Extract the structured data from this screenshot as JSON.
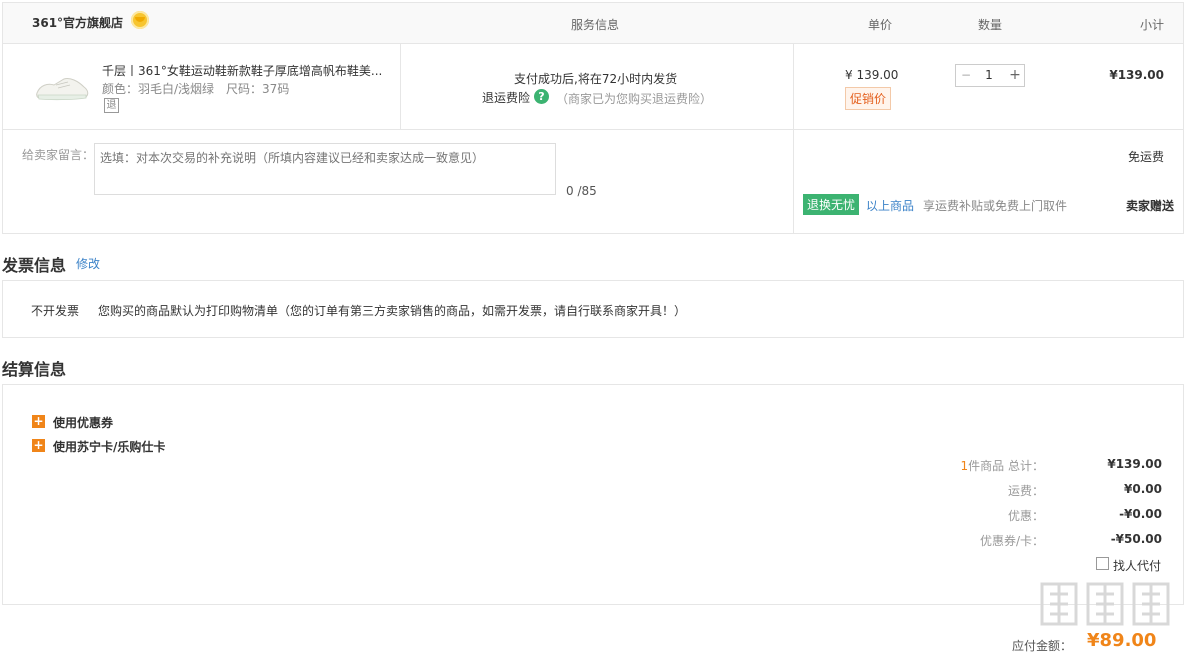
{
  "order": {
    "store_name": "361°官方旗舰店",
    "columns": {
      "service": "服务信息",
      "unit_price": "单价",
      "quantity": "数量",
      "subtotal": "小计"
    },
    "item": {
      "title": "千层丨361°女鞋运动鞋新款鞋子厚底增高帆布鞋美...",
      "color_size": "颜色：羽毛白/浅烟绿　尺码：37码",
      "return_tag": "退",
      "ship_info": "支付成功后,将在72小时内发货",
      "insurance_label": "退运费险",
      "insurance_note": "（商家已为您购买退运费险）",
      "unit_price": "¥ 139.00",
      "promo_tag": "促销价",
      "qty_minus": "−",
      "qty_value": "1",
      "qty_plus": "+",
      "subtotal": "¥139.00"
    },
    "message": {
      "label": "给卖家留言：",
      "placeholder": "选填：对本次交易的补充说明（所填内容建议已经和卖家达成一致意见）",
      "count": "0 /85"
    },
    "shipping": {
      "free_shipping": "免运费",
      "return_badge": "退换无忧",
      "return_link": "以上商品",
      "return_note": "享运费补贴或免费上门取件",
      "seller_gift": "卖家赠送"
    }
  },
  "invoice": {
    "title": "发票信息",
    "edit": "修改",
    "type": "不开发票",
    "text": "您购买的商品默认为打印购物清单（您的订单有第三方卖家销售的商品，如需开发票，请自行联系商家开具！）"
  },
  "settlement": {
    "title": "结算信息",
    "coupon": "使用优惠券",
    "card": "使用苏宁卡/乐购仕卡",
    "summary": {
      "count": "1",
      "count_label": "件商品 总计：",
      "total": "¥139.00",
      "shipping_label": "运费：",
      "shipping": "¥0.00",
      "discount_label": "优惠：",
      "discount": "-¥0.00",
      "coupon_label": "优惠券/卡：",
      "coupon": "-¥50.00",
      "proxy_pay": "找人代付"
    }
  },
  "footer": {
    "pay_label": "应付金额：",
    "pay_total": "¥89.00"
  },
  "watermark": {
    "url": "什么值得买"
  },
  "colors": {
    "accent": "#f08519",
    "green": "#3cb371",
    "link": "#3c83c8"
  }
}
